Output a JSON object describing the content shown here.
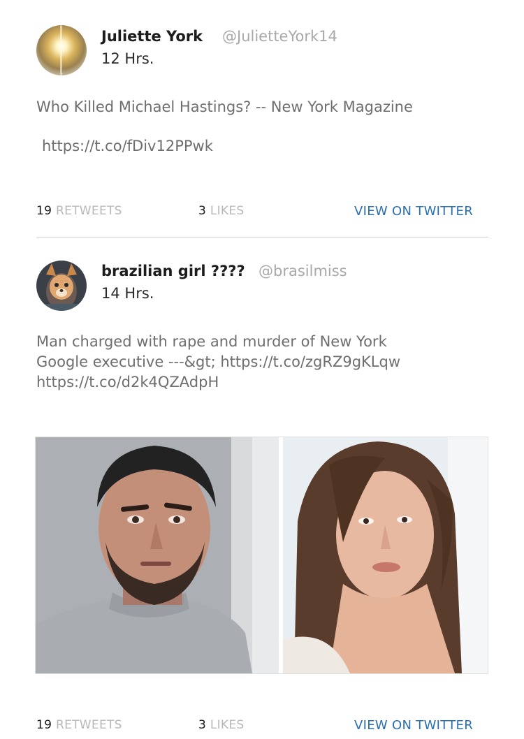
{
  "tweets": [
    {
      "name": "Juliette York",
      "handle": "@JulietteYork14",
      "time": "12 Hrs.",
      "text": "Who Killed Michael Hastings? -- New York Magazine",
      "link": "https://t.co/fDiv12PPwk",
      "retweets_count": "19",
      "retweets_label": "RETWEETS",
      "likes_count": "3",
      "likes_label": "LIKES",
      "view_label": "VIEW ON TWITTER"
    },
    {
      "name": "brazilian girl ????",
      "handle": "@brasilmiss",
      "time": "14 Hrs.",
      "text_line1": "Man charged with rape and murder of New York",
      "text_line2": "Google executive ---&gt; https://t.co/zgRZ9gKLqw",
      "text_line3": "https://t.co/d2k4QZAdpH",
      "retweets_count": "19",
      "retweets_label": "RETWEETS",
      "likes_count": "3",
      "likes_label": "LIKES",
      "view_label": "VIEW ON TWITTER"
    }
  ],
  "colors": {
    "link_blue": "#2a6fb0",
    "stat_label_gray": "#b8b8b8",
    "body_gray": "#6e6e6e"
  }
}
